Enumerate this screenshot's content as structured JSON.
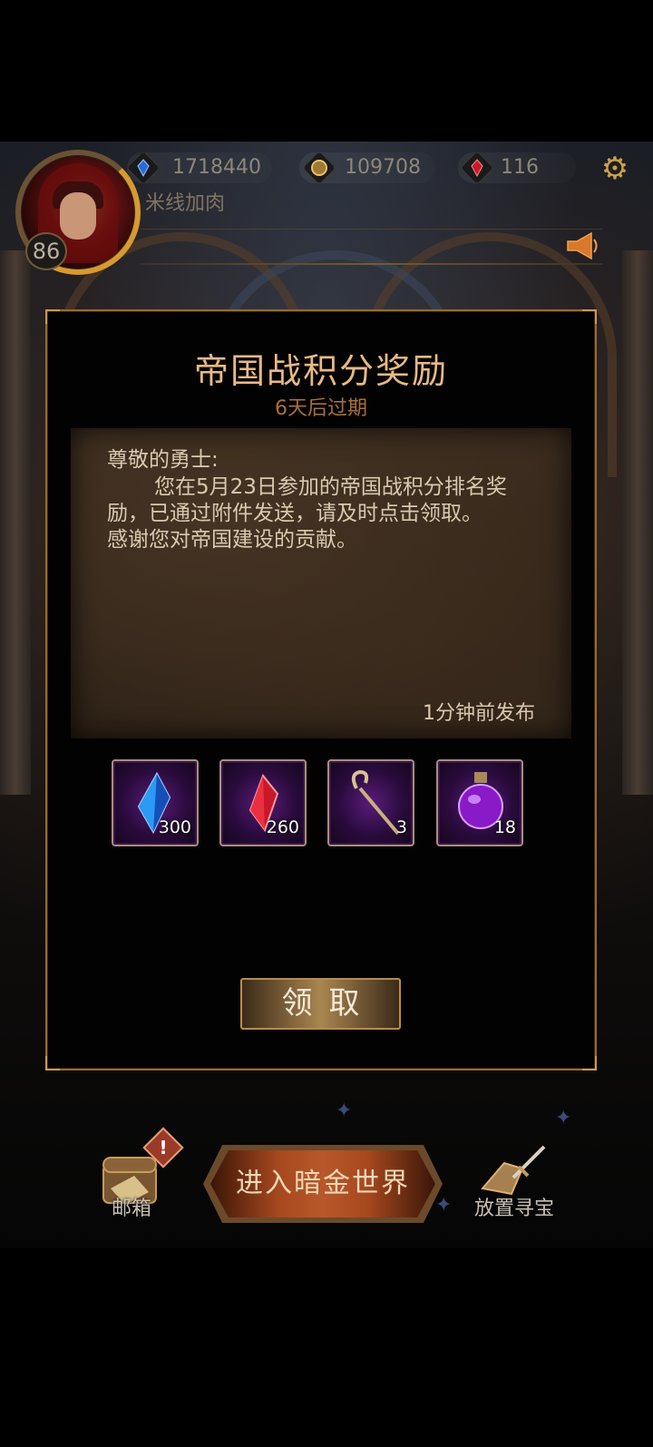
{
  "header": {
    "level": "86",
    "player_name": "米线加肉",
    "resources": [
      {
        "icon": "blue-crystal-icon",
        "value": "1718440"
      },
      {
        "icon": "gold-coin-icon",
        "value": "109708"
      },
      {
        "icon": "red-crystal-icon",
        "value": "116"
      }
    ]
  },
  "mail": {
    "title": "帝国战积分奖励",
    "expiry": "6天后过期",
    "greeting": "尊敬的勇士:",
    "body_lines": [
      "您在5月23日参加的帝国战积分排名奖",
      "励，已通过附件发送，请及时点击领取。",
      "感谢您对帝国建设的贡献。"
    ],
    "posted": "1分钟前发布",
    "attachments": [
      {
        "icon": "blue-crystal-icon",
        "qty": "300"
      },
      {
        "icon": "red-crystal-icon",
        "qty": "260"
      },
      {
        "icon": "staff-icon",
        "qty": "3"
      },
      {
        "icon": "purple-potion-icon",
        "qty": "18"
      }
    ],
    "claim_label": "领取"
  },
  "bottom_bar": {
    "mailbox_label": "邮箱",
    "mailbox_alert": "!",
    "enter_label": "进入暗金世界",
    "treasure_label": "放置寻宝"
  },
  "colors": {
    "title_gold": "#e7b985",
    "frame_bronze": "#9a6a2e",
    "slot_purple": "#5a1b7a"
  }
}
